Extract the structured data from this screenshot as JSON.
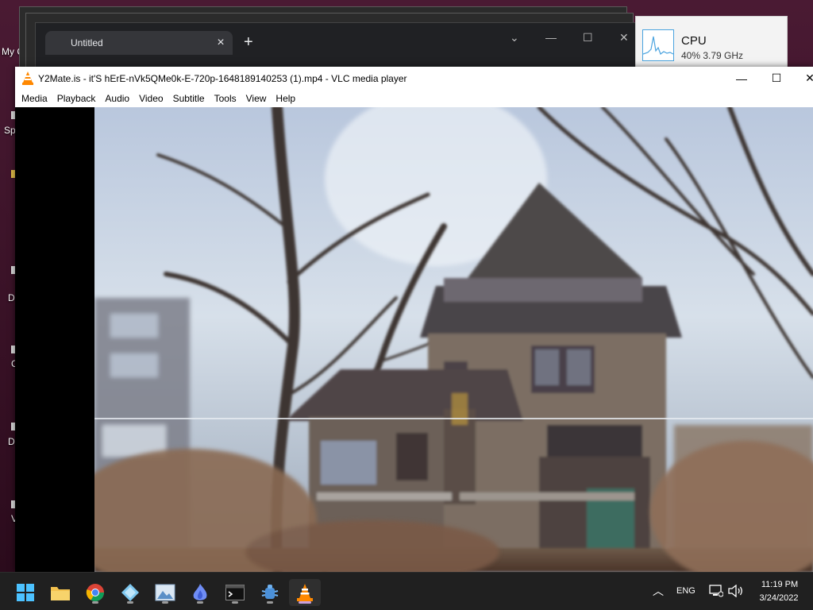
{
  "desktop": {
    "labels": [
      "My C",
      "Sp",
      "D",
      "C",
      "D",
      "V"
    ]
  },
  "browser": {
    "tab_title": "Untitled",
    "tab_close": "×",
    "new_tab": "+",
    "controls": {
      "chevron": "⌄",
      "minimize": "—",
      "maximize": "☐",
      "close": "✕"
    }
  },
  "cpu_widget": {
    "title": "CPU",
    "detail": "40% 3.79 GHz",
    "accent": "#4aa3df"
  },
  "vlc": {
    "title": "Y2Mate.is - it'S hErE-nVk5QMe0k-E-720p-1648189140253 (1).mp4 - VLC media player",
    "controls": {
      "minimize": "—",
      "maximize": "☐",
      "close": "✕"
    },
    "menu": [
      "Media",
      "Playback",
      "Audio",
      "Video",
      "Subtitle",
      "Tools",
      "View",
      "Help"
    ],
    "accent": "#ff8800"
  },
  "taskbar": {
    "apps": [
      {
        "name": "start-icon",
        "label": "Start"
      },
      {
        "name": "file-explorer-icon",
        "label": "File Explorer"
      },
      {
        "name": "chrome-icon",
        "label": "Google Chrome"
      },
      {
        "name": "diamond-app-icon",
        "label": "App"
      },
      {
        "name": "photos-icon",
        "label": "Photos"
      },
      {
        "name": "flame-app-icon",
        "label": "App"
      },
      {
        "name": "terminal-icon",
        "label": "Terminal"
      },
      {
        "name": "bug-app-icon",
        "label": "App"
      },
      {
        "name": "vlc-icon",
        "label": "VLC media player"
      }
    ],
    "language": "ENG",
    "time": "11:19 PM",
    "date": "3/24/2022"
  }
}
